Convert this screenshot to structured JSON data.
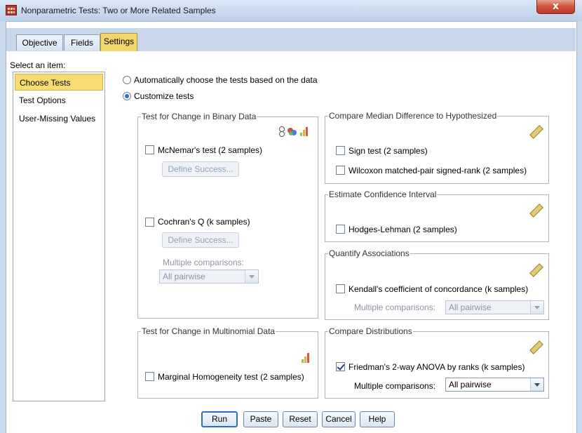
{
  "window": {
    "title": "Nonparametric Tests: Two or More Related Samples",
    "close_label": "x"
  },
  "tabs": [
    {
      "label": "Objective"
    },
    {
      "label": "Fields"
    },
    {
      "label": "Settings"
    }
  ],
  "sidebar": {
    "header": "Select an item:",
    "items": [
      {
        "label": "Choose Tests"
      },
      {
        "label": "Test Options"
      },
      {
        "label": "User-Missing Values"
      }
    ]
  },
  "mode": {
    "auto_label": "Automatically choose the tests based on the data",
    "custom_label": "Customize tests"
  },
  "binary": {
    "title": "Test for Change in Binary Data",
    "mcnemar_label": "McNemar's test (2 samples)",
    "mcnemar_define": "Define Success...",
    "cochran_label": "Cochran's Q (k samples)",
    "cochran_define": "Define Success...",
    "multiple_label": "Multiple comparisons:",
    "multiple_value": "All pairwise"
  },
  "median": {
    "title": "Compare Median Difference to Hypothesized",
    "sign_label": "Sign test (2 samples)",
    "wilcoxon_label": "Wilcoxon matched-pair signed-rank (2 samples)"
  },
  "confidence": {
    "title": "Estimate Confidence Interval",
    "hodges_label": "Hodges-Lehman (2 samples)"
  },
  "associations": {
    "title": "Quantify Associations",
    "kendall_label": "Kendall's coefficient of concordance (k samples)",
    "multiple_label": "Multiple comparisons:",
    "multiple_value": "All pairwise"
  },
  "multinomial": {
    "title": "Test for Change in Multinomial Data",
    "marginal_label": "Marginal Homogeneity test (2 samples)"
  },
  "distributions": {
    "title": "Compare Distributions",
    "friedman_label": "Friedman's 2-way ANOVA by ranks (k samples)",
    "multiple_label": "Multiple comparisons:",
    "multiple_value": "All pairwise"
  },
  "buttons": {
    "run": "Run",
    "paste": "Paste",
    "reset": "Reset",
    "cancel": "Cancel",
    "help": "Help"
  },
  "icons": {
    "ruler": "ruler-icon",
    "measure_levels": "measurement-level-icon",
    "bars": "ordinal-bars-icon"
  },
  "state": {
    "selected_tab": "Settings",
    "selected_item": "Choose Tests",
    "mode": "custom",
    "friedman_checked": true
  }
}
